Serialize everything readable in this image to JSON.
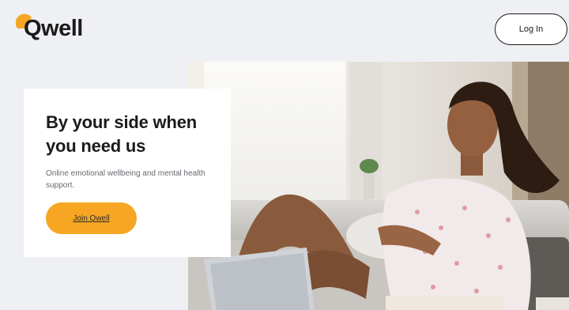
{
  "brand": {
    "name": "Qwell",
    "accent_color": "#f6a623",
    "logo_icon": "sun-arc-icon"
  },
  "header": {
    "login_label": "Log In"
  },
  "hero": {
    "title_line1": "By your side when",
    "title_line2": "you need us",
    "subtitle": "Online emotional wellbeing and mental health support.",
    "cta_label": "Join Qwell",
    "cta_color": "#f6a623",
    "image": "woman-relaxing-on-sofa-with-laptop"
  }
}
